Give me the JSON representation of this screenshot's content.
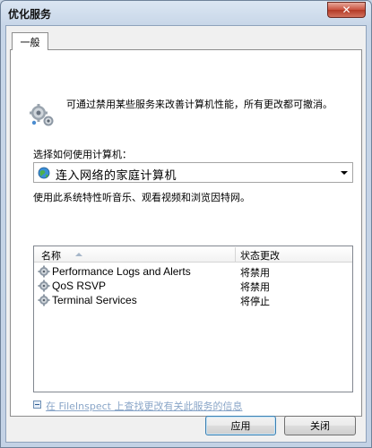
{
  "window": {
    "title": "优化服务",
    "close_glyph": "✕"
  },
  "tabs": [
    {
      "label": "一般",
      "selected": true
    }
  ],
  "intro_text": "可通过禁用某些服务来改善计算机性能，所有更改都可撤消。",
  "usage": {
    "label": "选择如何使用计算机：",
    "selected_option": "连入网络的家庭计算机",
    "description": "使用此系统特性听音乐、观看视频和浏览因特网。"
  },
  "services_list": {
    "columns": [
      "名称",
      "状态更改"
    ],
    "sort_column": "名称",
    "rows": [
      {
        "name": "Performance Logs and Alerts",
        "status": "将禁用"
      },
      {
        "name": "QoS RSVP",
        "status": "将禁用"
      },
      {
        "name": "Terminal Services",
        "status": "将停止"
      }
    ]
  },
  "link_text": "在 FileInspect 上查找更改有关此服务的信息",
  "buttons": {
    "apply": "应用",
    "close": "关闭"
  },
  "icons": {
    "intro": "gears-icon",
    "combo": "globe-network-icon",
    "row": "gear-service-icon",
    "link": "expand-icon"
  },
  "colors": {
    "title_bg": "#c7d6e8",
    "close_button": "#c9513e",
    "link": "#8aa6c8",
    "default_button_border": "#3c7fb1"
  }
}
